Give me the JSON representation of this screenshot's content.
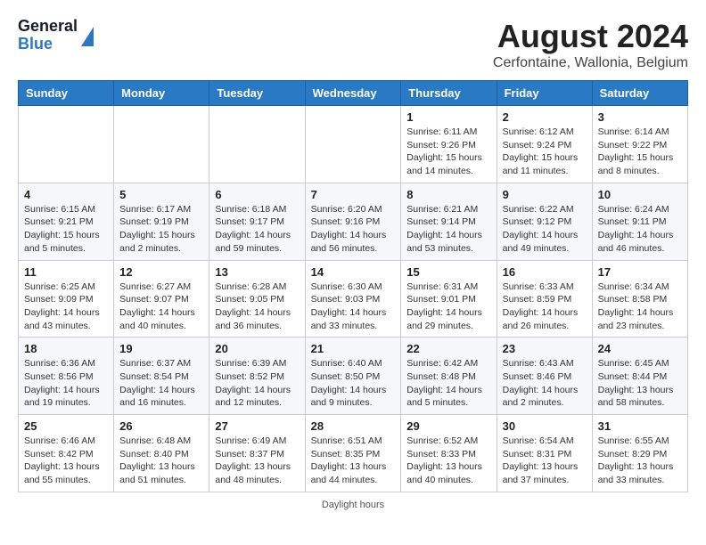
{
  "header": {
    "logo_line1": "General",
    "logo_line2": "Blue",
    "title": "August 2024",
    "subtitle": "Cerfontaine, Wallonia, Belgium"
  },
  "days_of_week": [
    "Sunday",
    "Monday",
    "Tuesday",
    "Wednesday",
    "Thursday",
    "Friday",
    "Saturday"
  ],
  "weeks": [
    [
      {
        "num": "",
        "info": ""
      },
      {
        "num": "",
        "info": ""
      },
      {
        "num": "",
        "info": ""
      },
      {
        "num": "",
        "info": ""
      },
      {
        "num": "1",
        "info": "Sunrise: 6:11 AM\nSunset: 9:26 PM\nDaylight: 15 hours\nand 14 minutes."
      },
      {
        "num": "2",
        "info": "Sunrise: 6:12 AM\nSunset: 9:24 PM\nDaylight: 15 hours\nand 11 minutes."
      },
      {
        "num": "3",
        "info": "Sunrise: 6:14 AM\nSunset: 9:22 PM\nDaylight: 15 hours\nand 8 minutes."
      }
    ],
    [
      {
        "num": "4",
        "info": "Sunrise: 6:15 AM\nSunset: 9:21 PM\nDaylight: 15 hours\nand 5 minutes."
      },
      {
        "num": "5",
        "info": "Sunrise: 6:17 AM\nSunset: 9:19 PM\nDaylight: 15 hours\nand 2 minutes."
      },
      {
        "num": "6",
        "info": "Sunrise: 6:18 AM\nSunset: 9:17 PM\nDaylight: 14 hours\nand 59 minutes."
      },
      {
        "num": "7",
        "info": "Sunrise: 6:20 AM\nSunset: 9:16 PM\nDaylight: 14 hours\nand 56 minutes."
      },
      {
        "num": "8",
        "info": "Sunrise: 6:21 AM\nSunset: 9:14 PM\nDaylight: 14 hours\nand 53 minutes."
      },
      {
        "num": "9",
        "info": "Sunrise: 6:22 AM\nSunset: 9:12 PM\nDaylight: 14 hours\nand 49 minutes."
      },
      {
        "num": "10",
        "info": "Sunrise: 6:24 AM\nSunset: 9:11 PM\nDaylight: 14 hours\nand 46 minutes."
      }
    ],
    [
      {
        "num": "11",
        "info": "Sunrise: 6:25 AM\nSunset: 9:09 PM\nDaylight: 14 hours\nand 43 minutes."
      },
      {
        "num": "12",
        "info": "Sunrise: 6:27 AM\nSunset: 9:07 PM\nDaylight: 14 hours\nand 40 minutes."
      },
      {
        "num": "13",
        "info": "Sunrise: 6:28 AM\nSunset: 9:05 PM\nDaylight: 14 hours\nand 36 minutes."
      },
      {
        "num": "14",
        "info": "Sunrise: 6:30 AM\nSunset: 9:03 PM\nDaylight: 14 hours\nand 33 minutes."
      },
      {
        "num": "15",
        "info": "Sunrise: 6:31 AM\nSunset: 9:01 PM\nDaylight: 14 hours\nand 29 minutes."
      },
      {
        "num": "16",
        "info": "Sunrise: 6:33 AM\nSunset: 8:59 PM\nDaylight: 14 hours\nand 26 minutes."
      },
      {
        "num": "17",
        "info": "Sunrise: 6:34 AM\nSunset: 8:58 PM\nDaylight: 14 hours\nand 23 minutes."
      }
    ],
    [
      {
        "num": "18",
        "info": "Sunrise: 6:36 AM\nSunset: 8:56 PM\nDaylight: 14 hours\nand 19 minutes."
      },
      {
        "num": "19",
        "info": "Sunrise: 6:37 AM\nSunset: 8:54 PM\nDaylight: 14 hours\nand 16 minutes."
      },
      {
        "num": "20",
        "info": "Sunrise: 6:39 AM\nSunset: 8:52 PM\nDaylight: 14 hours\nand 12 minutes."
      },
      {
        "num": "21",
        "info": "Sunrise: 6:40 AM\nSunset: 8:50 PM\nDaylight: 14 hours\nand 9 minutes."
      },
      {
        "num": "22",
        "info": "Sunrise: 6:42 AM\nSunset: 8:48 PM\nDaylight: 14 hours\nand 5 minutes."
      },
      {
        "num": "23",
        "info": "Sunrise: 6:43 AM\nSunset: 8:46 PM\nDaylight: 14 hours\nand 2 minutes."
      },
      {
        "num": "24",
        "info": "Sunrise: 6:45 AM\nSunset: 8:44 PM\nDaylight: 13 hours\nand 58 minutes."
      }
    ],
    [
      {
        "num": "25",
        "info": "Sunrise: 6:46 AM\nSunset: 8:42 PM\nDaylight: 13 hours\nand 55 minutes."
      },
      {
        "num": "26",
        "info": "Sunrise: 6:48 AM\nSunset: 8:40 PM\nDaylight: 13 hours\nand 51 minutes."
      },
      {
        "num": "27",
        "info": "Sunrise: 6:49 AM\nSunset: 8:37 PM\nDaylight: 13 hours\nand 48 minutes."
      },
      {
        "num": "28",
        "info": "Sunrise: 6:51 AM\nSunset: 8:35 PM\nDaylight: 13 hours\nand 44 minutes."
      },
      {
        "num": "29",
        "info": "Sunrise: 6:52 AM\nSunset: 8:33 PM\nDaylight: 13 hours\nand 40 minutes."
      },
      {
        "num": "30",
        "info": "Sunrise: 6:54 AM\nSunset: 8:31 PM\nDaylight: 13 hours\nand 37 minutes."
      },
      {
        "num": "31",
        "info": "Sunrise: 6:55 AM\nSunset: 8:29 PM\nDaylight: 13 hours\nand 33 minutes."
      }
    ]
  ],
  "footer": "Daylight hours"
}
